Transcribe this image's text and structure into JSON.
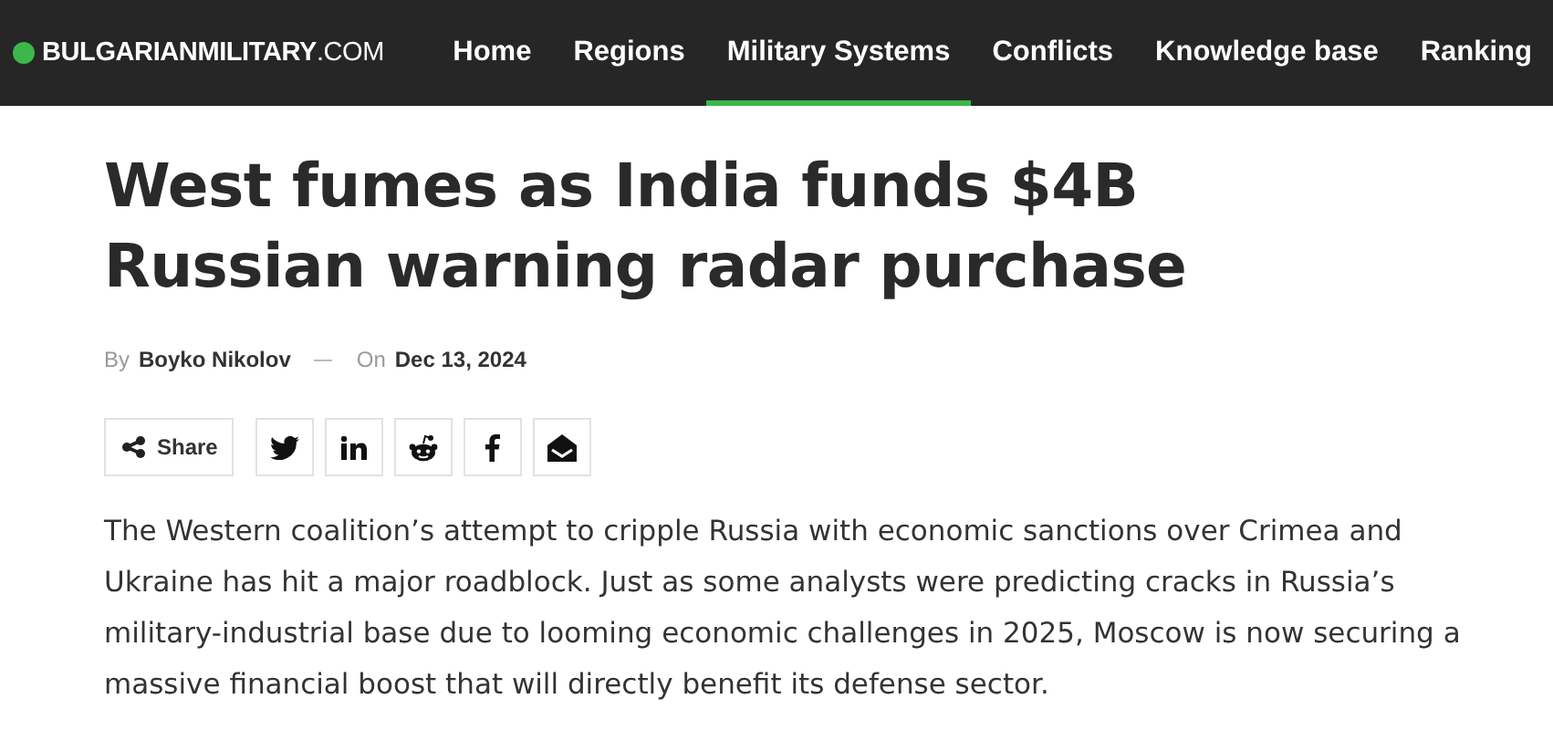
{
  "site": {
    "logo": "**BULGARIANMILITARY**.COM"
  },
  "nav": [
    {
      "label": "Home",
      "selected": false
    },
    {
      "label": "Regions",
      "selected": false
    },
    {
      "label": "Military Systems",
      "selected": true
    },
    {
      "label": "Conflicts",
      "selected": false
    },
    {
      "label": "Knowledge base",
      "selected": false
    },
    {
      "label": "Ranking",
      "selected": false
    }
  ],
  "article": {
    "title": "West fumes as India funds $4B Russian warning radar purchase",
    "byline": {
      "by": "By",
      "author": "Boyko Nikolov",
      "on": "On",
      "date": "Dec 13, 2024"
    },
    "share": {
      "label": "Share"
    },
    "social_buttons": [
      {
        "kind": "bird"
      },
      {
        "kind": "in"
      },
      {
        "kind": "alien"
      },
      {
        "kind": "f"
      },
      {
        "kind": "mail"
      }
    ],
    "body": "The Western coalition’s attempt to cripple Russia with economic sanctions over Crimea and Ukraine has hit a major roadblock. Just as some analysts were predicting cracks in Russia’s military-industrial base due to looming economic challenges in 2025, Moscow is now securing a massive financial boost that will directly benefit its defense sector."
  }
}
